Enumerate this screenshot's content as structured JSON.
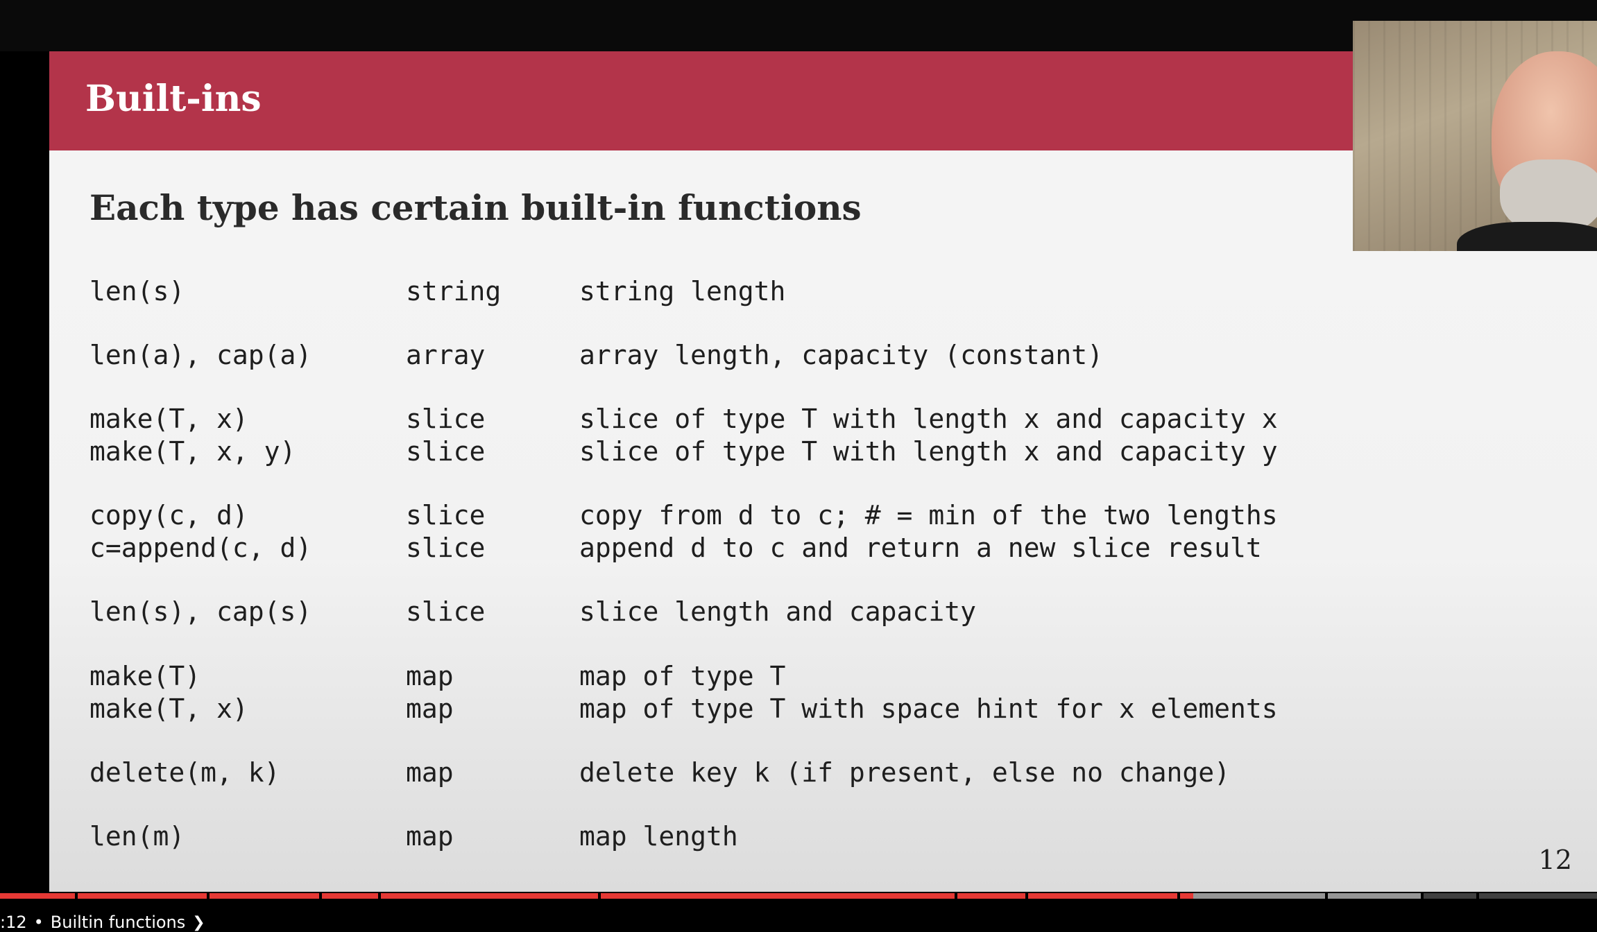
{
  "slide": {
    "title": "Built-ins",
    "subtitle": "Each type has certain built-in functions",
    "page_number": "12",
    "header_color": "#b3344a",
    "rows": [
      {
        "fn": "len(s)",
        "type": "string",
        "desc": "string length"
      },
      {
        "fn": "len(a), cap(a)",
        "type": "array",
        "desc": "array length, capacity (constant)"
      },
      {
        "fn": "make(T, x)",
        "type": "slice",
        "desc": "slice of type T with length x and capacity x"
      },
      {
        "fn": "make(T, x, y)",
        "type": "slice",
        "desc": "slice of type T with length x and capacity y"
      },
      {
        "fn": "copy(c, d)",
        "type": "slice",
        "desc": "copy from d to c; # = min of the two lengths"
      },
      {
        "fn": "c=append(c, d)",
        "type": "slice",
        "desc": "append d to c and return a new slice result"
      },
      {
        "fn": "len(s), cap(s)",
        "type": "slice",
        "desc": "slice length and capacity"
      },
      {
        "fn": "make(T)",
        "type": "map",
        "desc": "map of type T"
      },
      {
        "fn": "make(T, x)",
        "type": "map",
        "desc": "map of type T with space hint for x elements"
      },
      {
        "fn": "delete(m, k)",
        "type": "map",
        "desc": "delete key k (if present, else no change)"
      },
      {
        "fn": "len(m)",
        "type": "map",
        "desc": "map length"
      }
    ]
  },
  "player": {
    "progress_fraction": 0.747,
    "buffered_fraction": 0.89,
    "played_color": "#e53935",
    "chapter_time": ":12",
    "chapter_separator": "•",
    "chapter_title": "Builtin functions",
    "chevron": "chevron-right-icon"
  }
}
